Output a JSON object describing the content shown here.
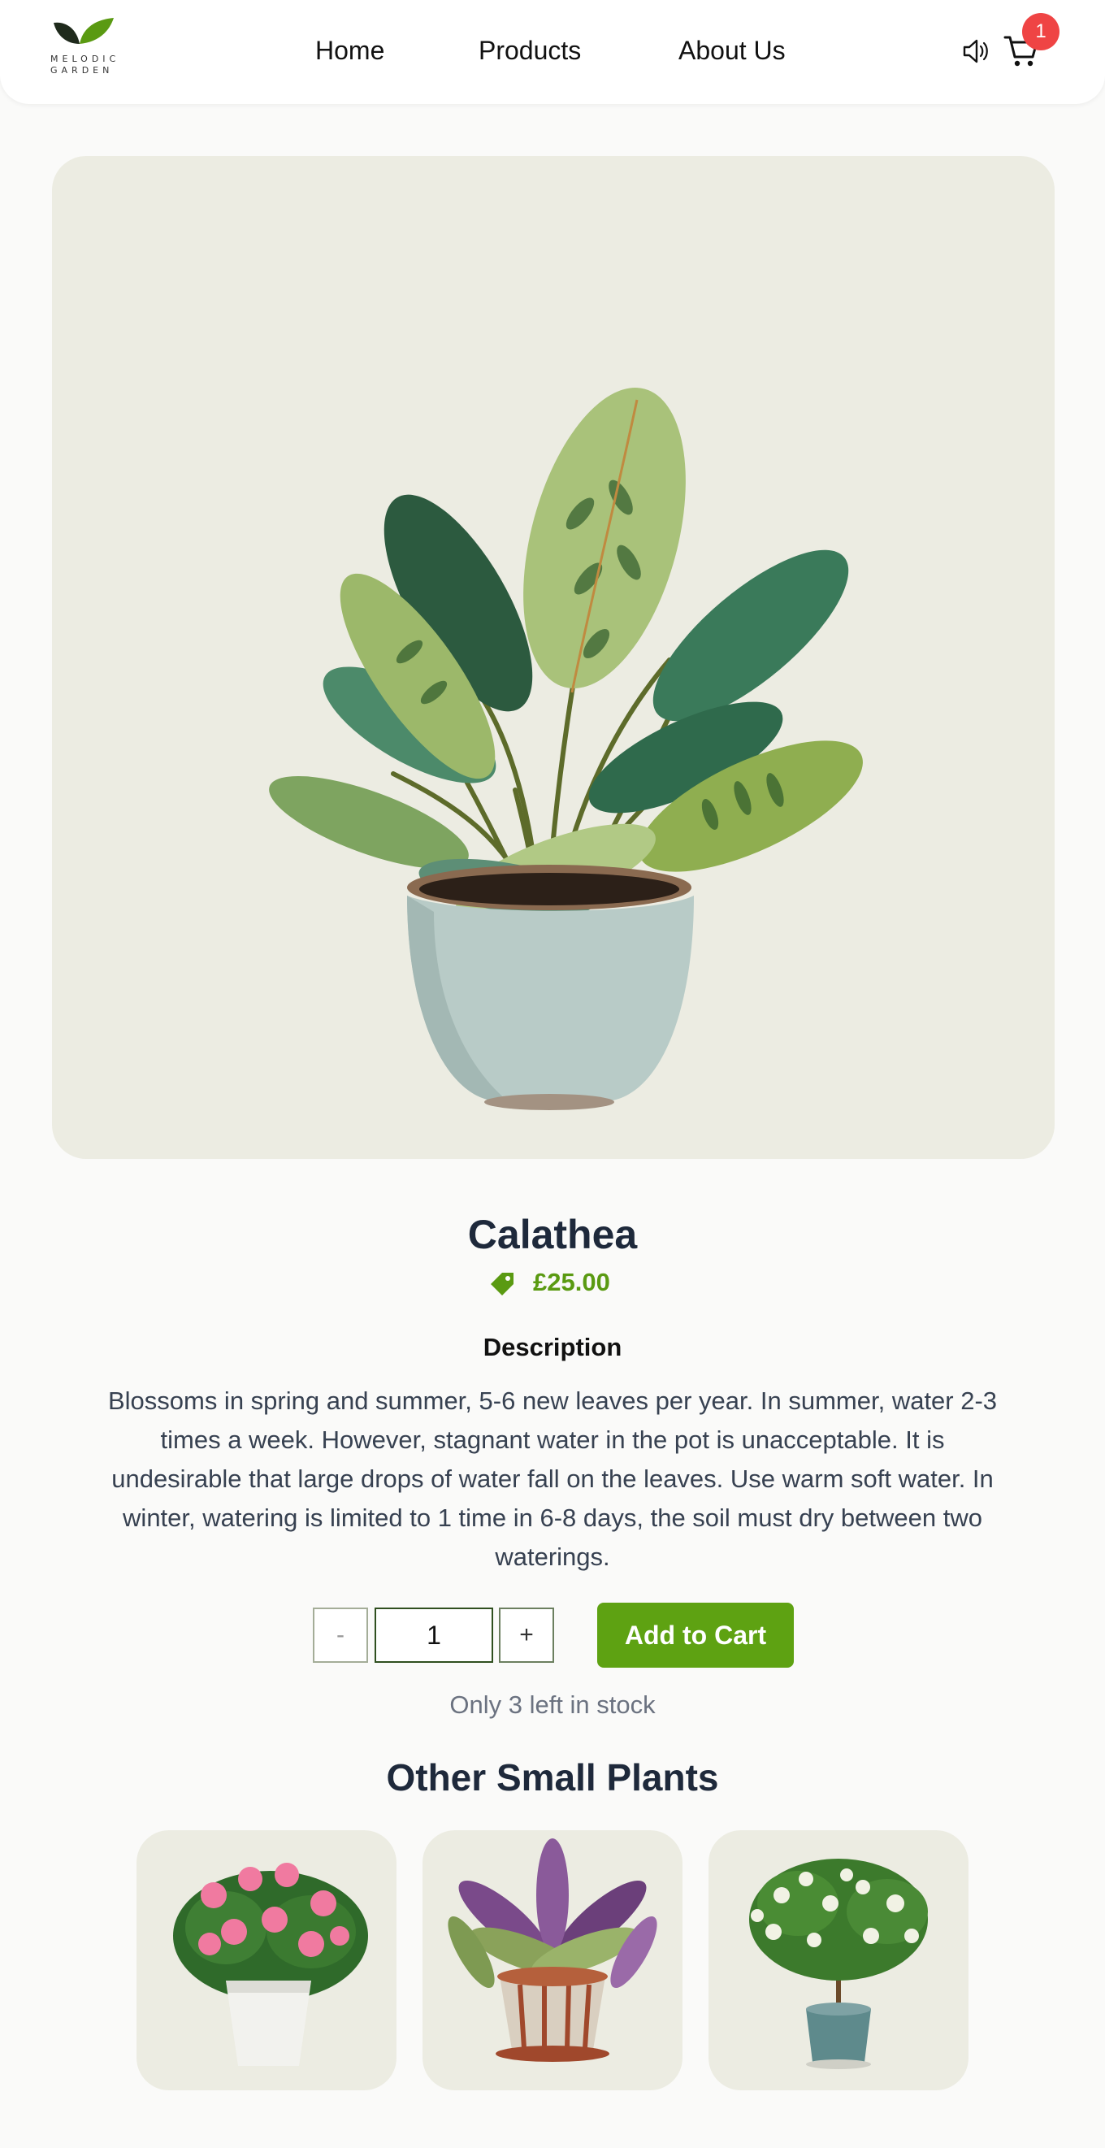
{
  "brand": {
    "line1": "MELODIC",
    "line2": "GARDEN"
  },
  "nav": {
    "home": "Home",
    "products": "Products",
    "about": "About Us"
  },
  "header": {
    "sound_icon": "speaker-icon",
    "cart_icon": "cart-icon",
    "cart_count": "1"
  },
  "product": {
    "name": "Calathea",
    "price": "£25.00",
    "price_icon": "price-tag-icon",
    "description_heading": "Description",
    "description": "Blossoms in spring and summer, 5-6 new leaves per year. In summer, water 2-3 times a week. However, stagnant water in the pot is unacceptable. It is undesirable that large drops of water fall on the leaves. Use warm soft water. In winter, watering is limited to 1 time in 6-8 days, the soil must dry between two waterings.",
    "quantity": "1",
    "minus_label": "-",
    "plus_label": "+",
    "add_to_cart": "Add to Cart",
    "stock_text": "Only 3 left in stock"
  },
  "related": {
    "heading": "Other Small Plants"
  },
  "colors": {
    "accent": "#5ea212",
    "price": "#5a9a12",
    "badge": "#ef4444",
    "image_bg": "#ecece2"
  }
}
